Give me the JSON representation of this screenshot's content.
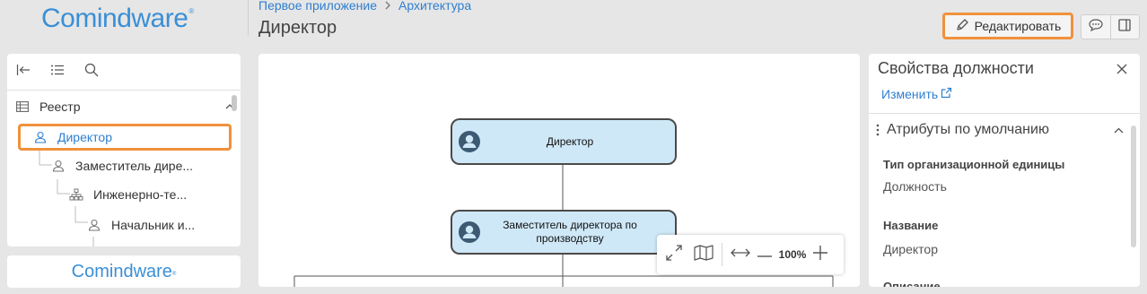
{
  "brand": {
    "logo_text": "Comindware",
    "trademark": "®"
  },
  "breadcrumb": {
    "items": [
      "Первое приложение",
      "Архитектура"
    ]
  },
  "page": {
    "title": "Директор"
  },
  "toolbar": {
    "edit_label": "Редактировать",
    "comments_icon": "comment-icon",
    "panel_icon": "panel-icon"
  },
  "colors": {
    "accent": "#f0913c",
    "link": "#2f7fd0",
    "node_fill": "#cfe8f8",
    "brand": "#3a8fd6"
  },
  "tree": {
    "items": [
      {
        "label": "Реестр",
        "icon": "table-icon"
      },
      {
        "label": "Директор",
        "icon": "person-icon"
      },
      {
        "label": "Заместитель дире...",
        "icon": "person-icon"
      },
      {
        "label": "Инженерно-те...",
        "icon": "org-icon"
      },
      {
        "label": "Начальник и...",
        "icon": "person-icon"
      }
    ]
  },
  "diagram": {
    "nodes": [
      {
        "label": "Директор"
      },
      {
        "label": "Заместитель директора по производству"
      }
    ],
    "zoom": "100%"
  },
  "properties": {
    "title": "Свойства должности",
    "edit_link": "Изменить",
    "section": "Атрибуты по умолчанию",
    "fields": [
      {
        "label": "Тип организационной единицы",
        "value": "Должность"
      },
      {
        "label": "Название",
        "value": "Директор"
      },
      {
        "label": "Описание",
        "value": ""
      }
    ]
  }
}
